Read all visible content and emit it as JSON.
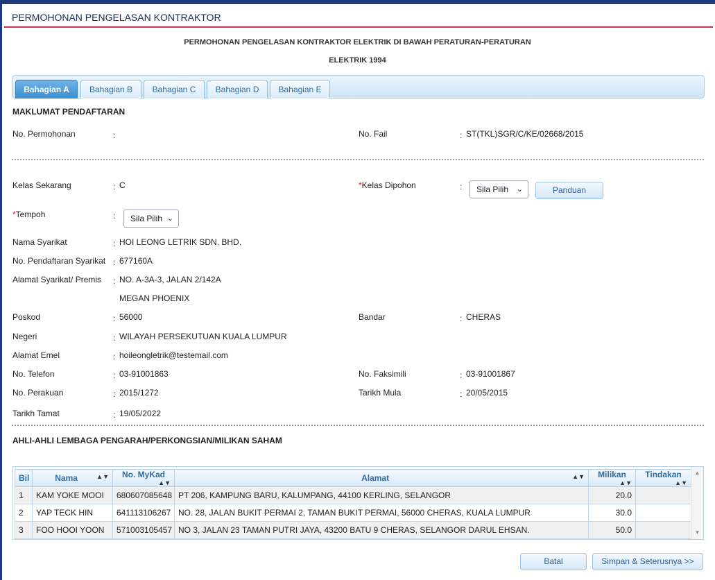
{
  "page": {
    "title": "PERMOHONAN PENGELASAN KONTRAKTOR",
    "form_title_line1": "PERMOHONAN PENGELASAN KONTRAKTOR ELEKTRIK DI BAWAH PERATURAN-PERATURAN",
    "form_title_line2": "ELEKTRIK 1994"
  },
  "tabs": [
    {
      "label": "Bahagian A",
      "active": true
    },
    {
      "label": "Bahagian B",
      "active": false
    },
    {
      "label": "Bahagian C",
      "active": false
    },
    {
      "label": "Bahagian D",
      "active": false
    },
    {
      "label": "Bahagian E",
      "active": false
    }
  ],
  "registration": {
    "heading": "MAKLUMAT PENDAFTARAN",
    "no_permohonan": {
      "label": "No. Permohonan",
      "value": ""
    },
    "no_fail": {
      "label": "No. Fail",
      "value": "ST(TKL)SGR/C/KE/02668/2015"
    },
    "kelas_sekarang": {
      "label": "Kelas Sekarang",
      "value": "C"
    },
    "kelas_dipohon": {
      "label": "Kelas Dipohon",
      "selected": "Sila Pilih"
    },
    "panduan_button": "Panduan",
    "tempoh": {
      "label": "Tempoh",
      "selected": "Sila Pilih"
    },
    "nama_syarikat": {
      "label": "Nama Syarikat",
      "value": "HOI LEONG LETRIK SDN. BHD."
    },
    "no_pendaftaran": {
      "label": "No. Pendaftaran Syarikat",
      "value": "677160A"
    },
    "alamat": {
      "label": "Alamat Syarikat/ Premis",
      "line1": "NO. A-3A-3, JALAN 2/142A",
      "line2": "MEGAN PHOENIX"
    },
    "poskod": {
      "label": "Poskod",
      "value": "56000"
    },
    "bandar": {
      "label": "Bandar",
      "value": "CHERAS"
    },
    "negeri": {
      "label": "Negeri",
      "value": "WILAYAH PERSEKUTUAN KUALA LUMPUR"
    },
    "emel": {
      "label": "Alamat Emel",
      "value": "hoileongletrik@testemail.com"
    },
    "telefon": {
      "label": "No. Telefon",
      "value": "03-91001863"
    },
    "faksimili": {
      "label": "No. Faksimili",
      "value": "03-91001867"
    },
    "perakuan": {
      "label": "No. Perakuan",
      "value": "2015/1272"
    },
    "tarikh_mula": {
      "label": "Tarikh Mula",
      "value": "20/05/2015"
    },
    "tarikh_tamat": {
      "label": "Tarikh Tamat",
      "value": "19/05/2022"
    }
  },
  "members": {
    "heading": "AHLI-AHLI LEMBAGA PENGARAH/PERKONGSIAN/MILIKAN SAHAM",
    "columns": [
      "Bil",
      "Nama",
      "No. MyKad",
      "Alamat",
      "Milikan",
      "Tindakan"
    ],
    "rows": [
      {
        "bil": "1",
        "nama": "KAM YOKE MOOI",
        "mykad": "680607085648",
        "alamat": "PT 206, KAMPUNG BARU, KALUMPANG, 44100 KERLING, SELANGOR",
        "milikan": "20.0",
        "tindakan": ""
      },
      {
        "bil": "2",
        "nama": "YAP TECK HIN",
        "mykad": "641113106267",
        "alamat": "NO. 28, JALAN BUKIT PERMAI 2, TAMAN BUKIT PERMAI, 56000 CHERAS, KUALA LUMPUR",
        "milikan": "30.0",
        "tindakan": ""
      },
      {
        "bil": "3",
        "nama": "FOO HOOI YOON",
        "mykad": "571003105457",
        "alamat": "NO 3, JALAN 23 TAMAN PUTRI JAYA, 43200 BATU 9 CHERAS, SELANGOR DARUL EHSAN.",
        "milikan": "50.0",
        "tindakan": ""
      }
    ]
  },
  "actions": {
    "batal": "Batal",
    "simpan": "Simpan & Seterusnya >>"
  }
}
